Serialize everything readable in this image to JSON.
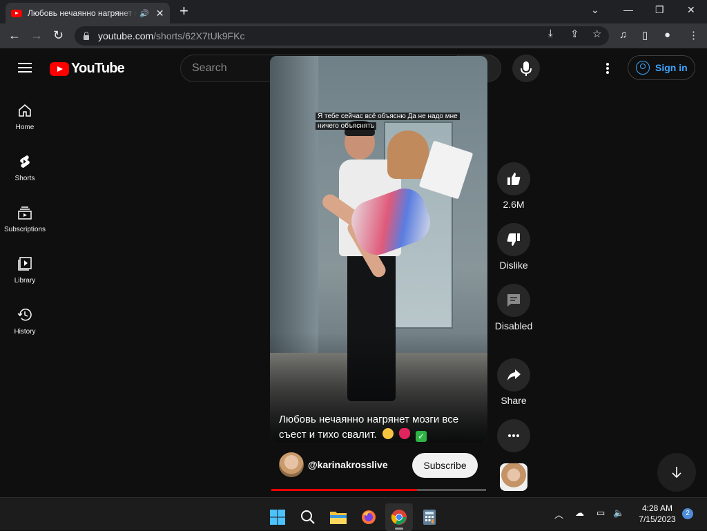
{
  "browser": {
    "tab_title": "Любовь нечаянно нагрянет мозги все съест и тихо свалит. 🤣 💔 ✅ - YouTube",
    "url_host": "youtube.com",
    "url_path": "/shorts/62X7tUk9FKc"
  },
  "header": {
    "logo_text": "YouTube",
    "search_placeholder": "Search",
    "signin_label": "Sign in"
  },
  "sidebar": {
    "items": [
      {
        "label": "Home",
        "icon": "home-icon"
      },
      {
        "label": "Shorts",
        "icon": "shorts-icon"
      },
      {
        "label": "Subscriptions",
        "icon": "subscriptions-icon"
      },
      {
        "label": "Library",
        "icon": "library-icon"
      },
      {
        "label": "History",
        "icon": "history-icon"
      }
    ]
  },
  "short": {
    "caption_lines": [
      "Я тебе сейчас всё объясню Да не надо мне",
      "ничего объяснять"
    ],
    "title_line1": "Любовь нечаянно нагрянет мозги все",
    "title_line2": "съест и тихо свалит.",
    "channel": "@karinakrosslive",
    "subscribe_label": "Subscribe",
    "progress": 0.68
  },
  "actions": {
    "likes": "2.6M",
    "dislike_label": "Dislike",
    "comments_label": "Disabled",
    "share_label": "Share"
  },
  "taskbar": {
    "time": "4:28 AM",
    "date": "7/15/2023",
    "notifications": "2"
  },
  "colors": {
    "youtube_red": "#ff0000",
    "link_blue": "#3ea6ff",
    "page_bg": "#0f0f0f"
  }
}
